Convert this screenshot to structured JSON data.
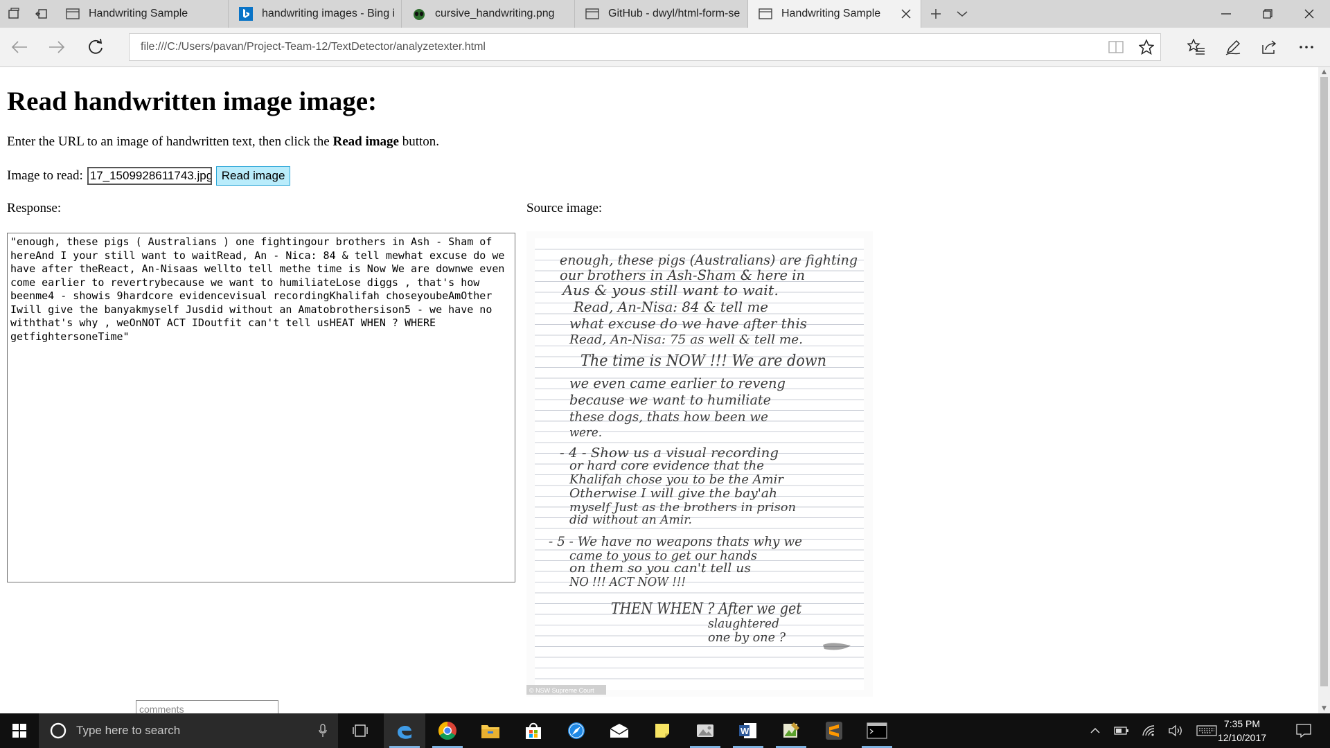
{
  "browser": {
    "tabs": [
      {
        "title": "Handwriting Sample",
        "icon": "page-icon",
        "active": false
      },
      {
        "title": "handwriting images - Bing i",
        "icon": "bing-icon",
        "active": false
      },
      {
        "title": "cursive_handwriting.png",
        "icon": "alien-icon",
        "active": false
      },
      {
        "title": "GitHub - dwyl/html-form-se",
        "icon": "page-icon",
        "active": false
      },
      {
        "title": "Handwriting Sample",
        "icon": "page-icon",
        "active": true
      }
    ],
    "url": "file:///C:/Users/pavan/Project-Team-12/TextDetector/analyzetexter.html"
  },
  "page": {
    "title": "Read handwritten image image:",
    "instruction_prefix": "Enter the URL to an image of handwritten text, then click the ",
    "instruction_bold": "Read image",
    "instruction_suffix": " button.",
    "image_label": "Image to read:",
    "image_value": "17_1509928611743.jpg",
    "read_button": "Read image",
    "response_label": "Response:",
    "source_label": "Source image:",
    "response_text": "\"enough, these pigs ( Australians ) one fightingour brothers in Ash - Sham of hereAnd I your still want to waitRead, An - Nica: 84 & tell mewhat excuse do we have after theReact, An-Nisaas wellto tell methe time is Now We are downwe even come earlier to revertrybecause we want to humiliateLose diggs , that's how beenme4 - showis 9hardcore evidencevisual recordingKhalifah choseyoubeAmOther Iwill give the banyakmyself Jusdid without an Amatobrothersison5 - we have no withthat's why , weOnNOT ACT IDoutfit can't tell usHEAT WHEN ? WHERE getfightersoneTime\"",
    "comments_placeholder": "comments",
    "image_credit": "© NSW Supreme Court",
    "handwriting_lines": [
      "enough, these pigs (Australians) are fighting",
      "our brothers in Ash-Sham & here in",
      "Aus & yous still want to wait.",
      "Read, An-Nisa: 84 & tell me",
      "what excuse do we have after this",
      "Read, An-Nisa: 75 as well & tell me.",
      "The time is NOW !!! We are down",
      "we even came earlier to reveng",
      "because we want to humiliate",
      "these dogs, thats how been we",
      "were.",
      "- 4 - Show us a visual recording",
      "or hard core evidence that the",
      "Khalifah chose you to be the Amir",
      "Otherwise I will give the bay'ah",
      "myself Just as the brothers in prison",
      "did without an Amir.",
      "- 5 - We have no weapons thats why we",
      "came to yous to get our hands",
      "on them so you can't tell us",
      "NO !!! ACT NOW !!!",
      "THEN WHEN ? After we get",
      "slaughtered",
      "one by one ?"
    ]
  },
  "taskbar": {
    "search_placeholder": "Type here to search",
    "time": "7:35 PM",
    "date": "12/10/2017"
  },
  "colors": {
    "read_button_bg": "#b9ecfb",
    "taskbar_bg": "#101010",
    "tab_strip_bg": "#d6d6d6"
  }
}
